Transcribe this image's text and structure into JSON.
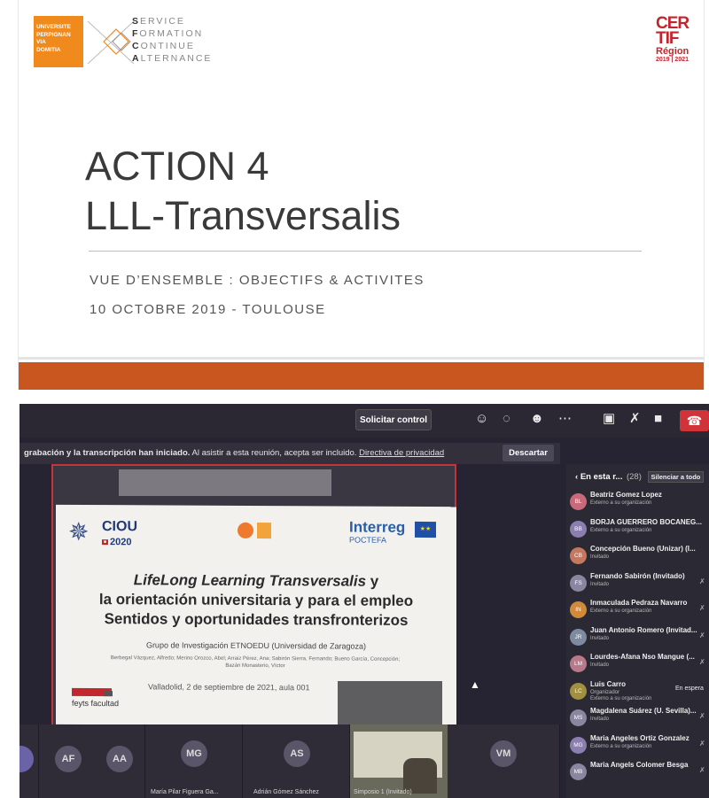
{
  "slide": {
    "upvd_logo": [
      "UNIVERSITE",
      "PERPIGNAN",
      "VIA",
      "DOMITIA"
    ],
    "sfca_lines": [
      {
        "first": "S",
        "rest": "ERVICE"
      },
      {
        "first": "F",
        "rest": "ORMATION"
      },
      {
        "first": "C",
        "rest": "ONTINUE"
      },
      {
        "first": "A",
        "rest": "LTERNANCE"
      }
    ],
    "certif": {
      "line1": "CER",
      "line2": "TIF",
      "region": "Région",
      "years": "2019 | 2021"
    },
    "title_line1": "ACTION 4",
    "title_line2": "LLL-Transversalis",
    "subtitle": "VUE D’ENSEMBLE : OBJECTIFS & ACTIVITES",
    "date_place": "10 OCTOBRE 2019 - TOULOUSE",
    "band_color": "#c9561f"
  },
  "teams": {
    "toolbar": {
      "control_button": "Solicitar control",
      "icons": [
        "people-icon",
        "chat-icon",
        "reactions-icon",
        "more-icon",
        "camera-off-icon",
        "mic-off-icon",
        "share-icon",
        "hangup-icon"
      ]
    },
    "notice": {
      "bold": "grabación y la transcripción han iniciado.",
      "text": "Al asistir a esta reunión, acepta ser incluido.",
      "link": "Directiva de privacidad",
      "dismiss": "Descartar"
    },
    "shared_slide": {
      "ciou_name": "CIOU",
      "ciou_year": "2020",
      "interreg": "Interreg",
      "interreg_sub": "POCTEFA",
      "line1_italic": "LifeLong Learning Transversalis",
      "line1_rest": " y",
      "line2": "la orientación universitaria y para el empleo",
      "line3": "Sentidos y oportunidades transfronterizos",
      "group": "Grupo de Investigación ETNOEDU (Universidad de Zaragoza)",
      "authors": "Berbegal Vázquez, Alfredo; Merino Orozco, Abel; Arraiz Pérez, Ana; Sabirón Sierra, Fernando; Bueno García, Concepción; Bazán Monasterio, Víctor",
      "date": "Valladolid, 2 de septiembre de 2021, aula 001",
      "feyts": "feyts facultad"
    },
    "strip": [
      {
        "initials": "AF",
        "name": ""
      },
      {
        "initials": "AA",
        "name": ""
      },
      {
        "initials": "MG",
        "name": "María Pilar Figuera Ga..."
      },
      {
        "initials": "AS",
        "name": "Adrián Gómez Sánchez"
      },
      {
        "initials": "",
        "name": "Simposio 1 (Invitado)"
      },
      {
        "initials": "VM",
        "name": ""
      }
    ],
    "panel": {
      "header": "En esta r...",
      "count": "(28)",
      "mute_all": "Silenciar a todo",
      "people": [
        {
          "initials": "BL",
          "name": "Beatriz Gomez Lopez",
          "sub": "Externo a su organización",
          "color": "#c96a7a",
          "extra": ""
        },
        {
          "initials": "BB",
          "name": "BORJA GUERRERO BOCANEG...",
          "sub": "Externo a su organización",
          "color": "#8a7fb0",
          "extra": ""
        },
        {
          "initials": "CB",
          "name": "Concepción Bueno (Unizar) (I...",
          "sub": "Invitado",
          "color": "#c47860",
          "extra": ""
        },
        {
          "initials": "FS",
          "name": "Fernando Sabirón (Invitado)",
          "sub": "Invitado",
          "color": "#8a86a0",
          "extra": "mic"
        },
        {
          "initials": "IN",
          "name": "Inmaculada Pedraza Navarro",
          "sub": "Externo a su organización",
          "color": "#d08a3a",
          "extra": "mic"
        },
        {
          "initials": "JR",
          "name": "Juan Antonio Romero (Invitad...",
          "sub": "Invitado",
          "color": "#7d8aa0",
          "extra": "mic"
        },
        {
          "initials": "LM",
          "name": "Lourdes-Afana Nso Mangue (...",
          "sub": "Invitado",
          "color": "#b87a8a",
          "extra": "mic"
        },
        {
          "initials": "LC",
          "name": "Luis Carro",
          "sub": "Organizador",
          "sub2": "Externo a su organización",
          "color": "#a09040",
          "extra": "En espera"
        },
        {
          "initials": "MS",
          "name": "Magdalena Suárez (U. Sevilla)...",
          "sub": "Invitado",
          "color": "#8a86a0",
          "extra": "mic"
        },
        {
          "initials": "MG",
          "name": "Maria Angeles Ortiz Gonzalez",
          "sub": "Externo a su organización",
          "color": "#8a7fb0",
          "extra": "mic"
        },
        {
          "initials": "MB",
          "name": "Maria Angels Colomer Besga",
          "sub": "",
          "color": "#8a86a0",
          "extra": "mic"
        }
      ]
    }
  }
}
